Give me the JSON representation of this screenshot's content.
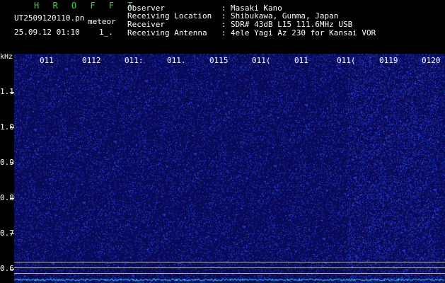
{
  "header": {
    "app_title": "H R O F F T",
    "filename": "UT2509120110.pn",
    "mode": "meteor",
    "datetime": "25.09.12 01:10",
    "counter": "1_.",
    "info": [
      {
        "label": "Observer",
        "sep": ":",
        "value": "Masaki Kano"
      },
      {
        "label": "Receiving Location",
        "sep": ":",
        "value": "Shibukawa, Gunma, Japan"
      },
      {
        "label": "Receiver",
        "sep": ":",
        "value": "SDR# 43dB L15 111.6MHz USB"
      },
      {
        "label": "Receiving Antenna",
        "sep": ":",
        "value": "4ele Yagi Az 230 for Kansai VOR"
      }
    ]
  },
  "spectrogram": {
    "unit": "kHz",
    "time_ticks": [
      "011",
      "0112",
      "011:",
      "011.",
      "0115",
      "011(",
      "011",
      "011(",
      "0119",
      "0120"
    ],
    "freq_ticks": [
      "1.1",
      "1.0",
      "0.9",
      "0.8",
      "0.7",
      "0.6"
    ],
    "colors": {
      "background": "#0a0a60",
      "speckle": "#3a5cff",
      "trace": "#30e0ff"
    }
  }
}
